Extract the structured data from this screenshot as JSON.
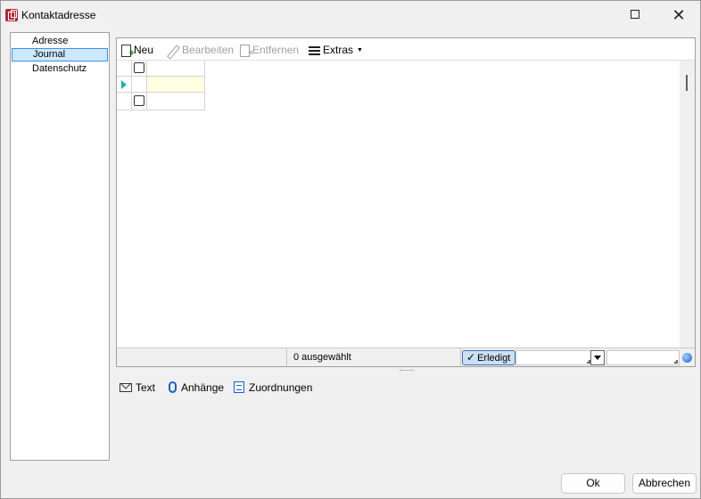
{
  "window": {
    "title": "Kontaktadresse"
  },
  "sidebar": {
    "items": [
      {
        "label": "Adresse",
        "selected": false
      },
      {
        "label": "Journal",
        "selected": true
      },
      {
        "label": "Datenschutz",
        "selected": false
      }
    ]
  },
  "toolbar": {
    "new_label": "Neu",
    "edit_label": "Bearbeiten",
    "delete_label": "Entfernen",
    "extras_label": "Extras"
  },
  "status": {
    "selected_count": "0 ausgewählt",
    "done_label": "Erledigt"
  },
  "tabs": {
    "text_label": "Text",
    "attachments_label": "Anhänge",
    "assignments_label": "Zuordnungen"
  },
  "buttons": {
    "ok_label": "Ok",
    "cancel_label": "Abbrechen"
  },
  "colors": {
    "selection": "#cce8ff",
    "accent": "#1a5fc2",
    "row_indicator": "#2aa9b5",
    "app_icon": "#b3273a"
  }
}
